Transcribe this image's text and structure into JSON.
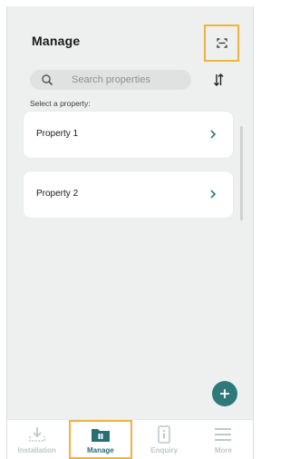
{
  "header": {
    "title": "Manage",
    "scan_icon": "scan-frame-icon"
  },
  "search": {
    "placeholder": "Search properties",
    "value": ""
  },
  "sort_icon": "sort-arrows-icon",
  "select_label": "Select a property:",
  "properties": [
    {
      "name": "Property 1"
    },
    {
      "name": "Property 2"
    }
  ],
  "fab_icon": "plus-icon",
  "nav": {
    "items": [
      {
        "label": "Installation",
        "icon": "download-icon",
        "active": false
      },
      {
        "label": "Manage",
        "icon": "folder-icon",
        "active": true
      },
      {
        "label": "Enquiry",
        "icon": "info-device-icon",
        "active": false
      },
      {
        "label": "More",
        "icon": "menu-icon",
        "active": false
      }
    ]
  },
  "colors": {
    "accent": "#2e7a7a",
    "highlight": "#f2b13f",
    "background": "#eef0ef",
    "nav_inactive": "#bcc9c8"
  }
}
